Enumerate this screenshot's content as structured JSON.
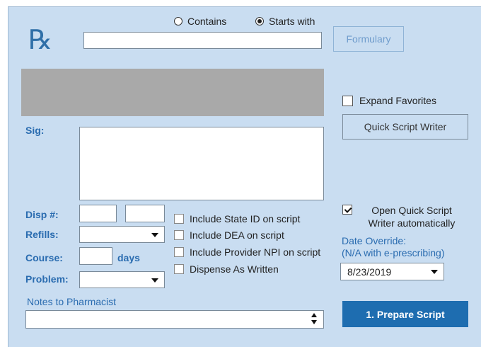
{
  "logo": "℞",
  "search": {
    "contains_label": "Contains",
    "starts_with_label": "Starts with",
    "selected": "starts_with",
    "value": ""
  },
  "formulary_label": "Formulary",
  "expand_favorites": {
    "label": "Expand Favorites",
    "checked": false
  },
  "quick_script_writer_label": "Quick Script Writer",
  "sig_label": "Sig:",
  "disp_label": "Disp #:",
  "refills_label": "Refills:",
  "course_label": "Course:",
  "days_label": "days",
  "problem_label": "Problem:",
  "checkboxes": [
    {
      "label": "Include State ID on script",
      "checked": false
    },
    {
      "label": "Include DEA on script",
      "checked": false
    },
    {
      "label": "Include Provider NPI on script",
      "checked": false
    },
    {
      "label": "Dispense As Written",
      "checked": false
    }
  ],
  "open_quick_script": {
    "line1": "Open Quick Script",
    "line2": "Writer automatically",
    "checked": true
  },
  "date_override": {
    "line1": "Date Override:",
    "line2": "(N/A with e-prescribing)",
    "value": "8/23/2019"
  },
  "notes_label": "Notes to Pharmacist",
  "prepare_button_label": "1. Prepare Script",
  "colors": {
    "panel": "#c9ddf1",
    "accent": "#1e6db0",
    "label_blue": "#2a6cb0",
    "gray_box": "#a9a9a9"
  }
}
